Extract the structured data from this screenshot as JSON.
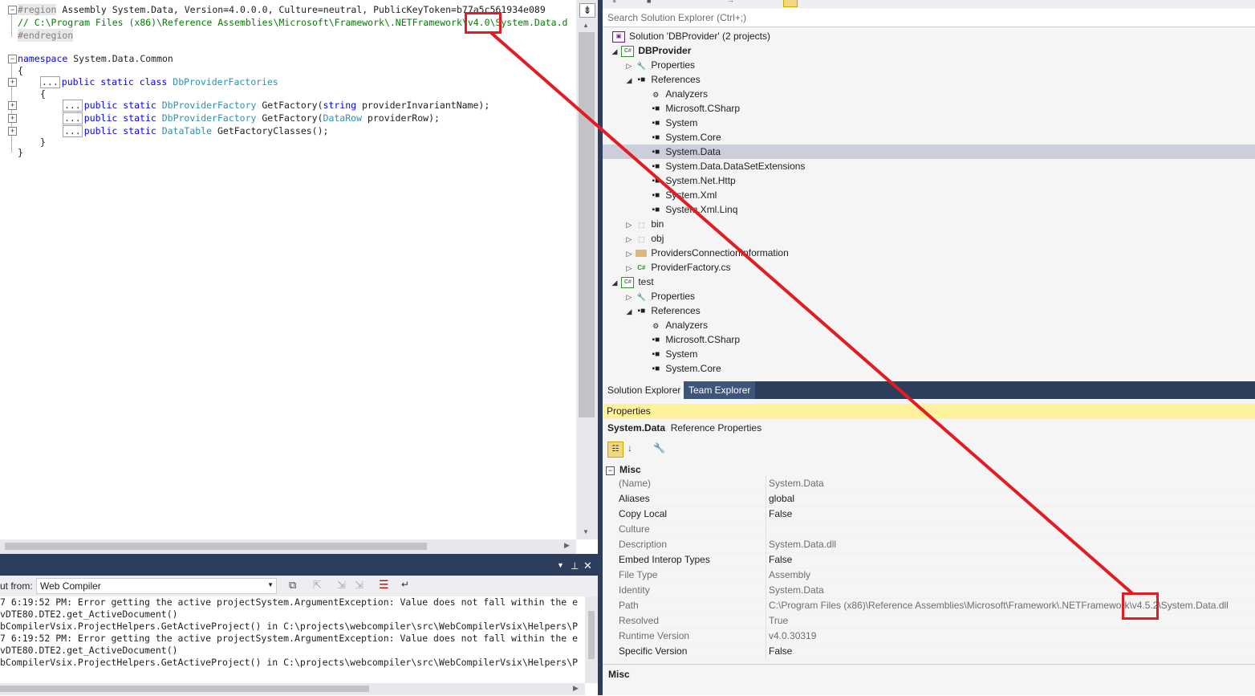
{
  "editor": {
    "region_keyword": "#region",
    "region_text": " Assembly System.Data, Version=4.0.0.0, Culture=neutral, PublicKeyToken=b77a5c561934e089",
    "path_comment_prefix": "// C:\\Program Files (x86)\\Reference Assemblies\\Microsoft\\Framework\\.NETFramework\\",
    "path_version": "v4.0",
    "path_comment_suffix": "\\System.Data.d",
    "endregion": "#endregion",
    "namespace_kw": "namespace",
    "namespace_name": " System.Data.Common",
    "open_brace": "{",
    "close_brace": "}",
    "class_line": {
      "ellipsis": "...",
      "kw": "public static class",
      "type": "DbProviderFactories"
    },
    "members": [
      {
        "ellipsis": "...",
        "kw": "public static",
        "type": "DbProviderFactory",
        "rest_a": " GetFactory(",
        "param_kw": "string",
        "rest_b": " providerInvariantName);"
      },
      {
        "ellipsis": "...",
        "kw": "public static",
        "type": "DbProviderFactory",
        "rest_a": " GetFactory(",
        "param_type": "DataRow",
        "rest_b": " providerRow);"
      },
      {
        "ellipsis": "...",
        "kw": "public static",
        "type": "DataTable",
        "rest_a": " GetFactoryClasses();"
      }
    ]
  },
  "output": {
    "show_from_label": "ut from:",
    "source_value": "Web Compiler",
    "lines": [
      "7 6:19:52 PM: Error getting the active projectSystem.ArgumentException: Value does not fall within the e",
      "vDTE80.DTE2.get_ActiveDocument()",
      "bCompilerVsix.ProjectHelpers.GetActiveProject() in C:\\projects\\webcompiler\\src\\WebCompilerVsix\\Helpers\\P",
      "7 6:19:52 PM: Error getting the active projectSystem.ArgumentException: Value does not fall within the e",
      "vDTE80.DTE2.get_ActiveDocument()",
      "bCompilerVsix.ProjectHelpers.GetActiveProject() in C:\\projects\\webcompiler\\src\\WebCompilerVsix\\Helpers\\P"
    ]
  },
  "solution_explorer": {
    "search_placeholder": "Search Solution Explorer (Ctrl+;)",
    "solution_label": "Solution 'DBProvider' (2 projects)",
    "tree": [
      {
        "label": "DBProvider",
        "indent": 0,
        "arrow": "◢",
        "icon": "cs",
        "bold": true
      },
      {
        "label": "Properties",
        "indent": 1,
        "arrow": "▷",
        "icon": "wrench"
      },
      {
        "label": "References",
        "indent": 1,
        "arrow": "◢",
        "icon": "ref"
      },
      {
        "label": "Analyzers",
        "indent": 2,
        "arrow": "",
        "icon": "analyzer"
      },
      {
        "label": "Microsoft.CSharp",
        "indent": 2,
        "arrow": "",
        "icon": "ref"
      },
      {
        "label": "System",
        "indent": 2,
        "arrow": "",
        "icon": "ref"
      },
      {
        "label": "System.Core",
        "indent": 2,
        "arrow": "",
        "icon": "ref"
      },
      {
        "label": "System.Data",
        "indent": 2,
        "arrow": "",
        "icon": "ref",
        "selected": true
      },
      {
        "label": "System.Data.DataSetExtensions",
        "indent": 2,
        "arrow": "",
        "icon": "ref"
      },
      {
        "label": "System.Net.Http",
        "indent": 2,
        "arrow": "",
        "icon": "ref"
      },
      {
        "label": "System.Xml",
        "indent": 2,
        "arrow": "",
        "icon": "ref"
      },
      {
        "label": "System.Xml.Linq",
        "indent": 2,
        "arrow": "",
        "icon": "ref"
      },
      {
        "label": "bin",
        "indent": 1,
        "arrow": "▷",
        "icon": "folder-dashed"
      },
      {
        "label": "obj",
        "indent": 1,
        "arrow": "▷",
        "icon": "folder-dashed"
      },
      {
        "label": "ProvidersConnectionInformation",
        "indent": 1,
        "arrow": "▷",
        "icon": "folder"
      },
      {
        "label": "ProviderFactory.cs",
        "indent": 1,
        "arrow": "▷",
        "icon": "csfile"
      },
      {
        "label": "test",
        "indent": 0,
        "arrow": "◢",
        "icon": "cs"
      },
      {
        "label": "Properties",
        "indent": 1,
        "arrow": "▷",
        "icon": "wrench"
      },
      {
        "label": "References",
        "indent": 1,
        "arrow": "◢",
        "icon": "ref"
      },
      {
        "label": "Analyzers",
        "indent": 2,
        "arrow": "",
        "icon": "analyzer"
      },
      {
        "label": "Microsoft.CSharp",
        "indent": 2,
        "arrow": "",
        "icon": "ref"
      },
      {
        "label": "System",
        "indent": 2,
        "arrow": "",
        "icon": "ref"
      },
      {
        "label": "System.Core",
        "indent": 2,
        "arrow": "",
        "icon": "ref"
      }
    ],
    "tabs": [
      "Solution Explorer",
      "Team Explorer"
    ]
  },
  "properties": {
    "title": "Properties",
    "object_name": "System.Data",
    "object_type": "Reference Properties",
    "category": "Misc",
    "rows": [
      {
        "name": "(Name)",
        "value": "System.Data",
        "readonly": true
      },
      {
        "name": "Aliases",
        "value": "global",
        "readonly": false
      },
      {
        "name": "Copy Local",
        "value": "False",
        "readonly": false
      },
      {
        "name": "Culture",
        "value": "",
        "readonly": true
      },
      {
        "name": "Description",
        "value": "System.Data.dll",
        "readonly": true
      },
      {
        "name": "Embed Interop Types",
        "value": "False",
        "readonly": false
      },
      {
        "name": "File Type",
        "value": "Assembly",
        "readonly": true
      },
      {
        "name": "Identity",
        "value": "System.Data",
        "readonly": true
      },
      {
        "name": "Path",
        "value": "C:\\Program Files (x86)\\Reference Assemblies\\Microsoft\\Framework\\.NETFramework\\v4.5.2\\System.Data.dll",
        "readonly": true
      },
      {
        "name": "Resolved",
        "value": "True",
        "readonly": true
      },
      {
        "name": "Runtime Version",
        "value": "v4.0.30319",
        "readonly": true
      },
      {
        "name": "Specific Version",
        "value": "False",
        "readonly": false
      }
    ],
    "description_title": "Misc"
  },
  "colors": {
    "annotation": "#e31b23",
    "vs_dark": "#2d3e5c",
    "selection": "#cccedb"
  }
}
